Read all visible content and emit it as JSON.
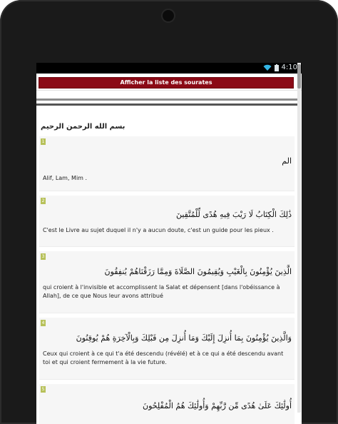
{
  "status": {
    "time": "4:10"
  },
  "header": {
    "button_label": "Afficher la liste des sourates"
  },
  "basmala": "بسم الله الرحمن الرحيم",
  "verses": [
    {
      "number": "1",
      "arabic": "الم",
      "translation": "Alif, Lam, Mim ."
    },
    {
      "number": "2",
      "arabic": "ذَٰلِكَ الْكِتَابُ لَا رَيْبَ فِيهِ هُدًى لِّلْمُتَّقِينَ",
      "translation": "C'est le Livre au sujet duquel il n'y a aucun doute, c'est un guide pour les pieux ."
    },
    {
      "number": "3",
      "arabic": "الَّذِينَ يُؤْمِنُونَ بِالْغَيْبِ وَيُقِيمُونَ الصَّلَاةَ وَمِمَّا رَزَقْنَاهُمْ يُنفِقُونَ",
      "translation": "qui croient à l'invisible et accomplissent la Salat et dépensent [dans l'obéissance à Allah], de ce que Nous leur avons attribué"
    },
    {
      "number": "4",
      "arabic": "وَالَّذِينَ يُؤْمِنُونَ بِمَا أُنزِلَ إِلَيْكَ وَمَا أُنزِلَ مِن قَبْلِكَ وَبِالْآخِرَةِ هُمْ يُوقِنُونَ",
      "translation": "Ceux qui croient à ce qui t'a été descendu (révélé) et à ce qui a été descendu avant toi et qui croient fermement à la vie future."
    },
    {
      "number": "5",
      "arabic": "أُولَٰئِكَ عَلَىٰ هُدًى مِّن رَّبِّهِمْ وَأُولَٰئِكَ هُمُ الْمُفْلِحُونَ",
      "translation": ""
    }
  ]
}
